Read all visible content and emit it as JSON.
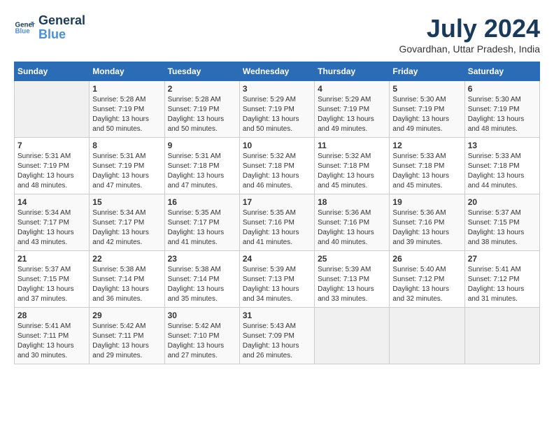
{
  "header": {
    "logo_line1": "General",
    "logo_line2": "Blue",
    "month_year": "July 2024",
    "location": "Govardhan, Uttar Pradesh, India"
  },
  "days_of_week": [
    "Sunday",
    "Monday",
    "Tuesday",
    "Wednesday",
    "Thursday",
    "Friday",
    "Saturday"
  ],
  "weeks": [
    [
      {
        "day": "",
        "content": ""
      },
      {
        "day": "1",
        "content": "Sunrise: 5:28 AM\nSunset: 7:19 PM\nDaylight: 13 hours\nand 50 minutes."
      },
      {
        "day": "2",
        "content": "Sunrise: 5:28 AM\nSunset: 7:19 PM\nDaylight: 13 hours\nand 50 minutes."
      },
      {
        "day": "3",
        "content": "Sunrise: 5:29 AM\nSunset: 7:19 PM\nDaylight: 13 hours\nand 50 minutes."
      },
      {
        "day": "4",
        "content": "Sunrise: 5:29 AM\nSunset: 7:19 PM\nDaylight: 13 hours\nand 49 minutes."
      },
      {
        "day": "5",
        "content": "Sunrise: 5:30 AM\nSunset: 7:19 PM\nDaylight: 13 hours\nand 49 minutes."
      },
      {
        "day": "6",
        "content": "Sunrise: 5:30 AM\nSunset: 7:19 PM\nDaylight: 13 hours\nand 48 minutes."
      }
    ],
    [
      {
        "day": "7",
        "content": "Sunrise: 5:31 AM\nSunset: 7:19 PM\nDaylight: 13 hours\nand 48 minutes."
      },
      {
        "day": "8",
        "content": "Sunrise: 5:31 AM\nSunset: 7:19 PM\nDaylight: 13 hours\nand 47 minutes."
      },
      {
        "day": "9",
        "content": "Sunrise: 5:31 AM\nSunset: 7:18 PM\nDaylight: 13 hours\nand 47 minutes."
      },
      {
        "day": "10",
        "content": "Sunrise: 5:32 AM\nSunset: 7:18 PM\nDaylight: 13 hours\nand 46 minutes."
      },
      {
        "day": "11",
        "content": "Sunrise: 5:32 AM\nSunset: 7:18 PM\nDaylight: 13 hours\nand 45 minutes."
      },
      {
        "day": "12",
        "content": "Sunrise: 5:33 AM\nSunset: 7:18 PM\nDaylight: 13 hours\nand 45 minutes."
      },
      {
        "day": "13",
        "content": "Sunrise: 5:33 AM\nSunset: 7:18 PM\nDaylight: 13 hours\nand 44 minutes."
      }
    ],
    [
      {
        "day": "14",
        "content": "Sunrise: 5:34 AM\nSunset: 7:17 PM\nDaylight: 13 hours\nand 43 minutes."
      },
      {
        "day": "15",
        "content": "Sunrise: 5:34 AM\nSunset: 7:17 PM\nDaylight: 13 hours\nand 42 minutes."
      },
      {
        "day": "16",
        "content": "Sunrise: 5:35 AM\nSunset: 7:17 PM\nDaylight: 13 hours\nand 41 minutes."
      },
      {
        "day": "17",
        "content": "Sunrise: 5:35 AM\nSunset: 7:16 PM\nDaylight: 13 hours\nand 41 minutes."
      },
      {
        "day": "18",
        "content": "Sunrise: 5:36 AM\nSunset: 7:16 PM\nDaylight: 13 hours\nand 40 minutes."
      },
      {
        "day": "19",
        "content": "Sunrise: 5:36 AM\nSunset: 7:16 PM\nDaylight: 13 hours\nand 39 minutes."
      },
      {
        "day": "20",
        "content": "Sunrise: 5:37 AM\nSunset: 7:15 PM\nDaylight: 13 hours\nand 38 minutes."
      }
    ],
    [
      {
        "day": "21",
        "content": "Sunrise: 5:37 AM\nSunset: 7:15 PM\nDaylight: 13 hours\nand 37 minutes."
      },
      {
        "day": "22",
        "content": "Sunrise: 5:38 AM\nSunset: 7:14 PM\nDaylight: 13 hours\nand 36 minutes."
      },
      {
        "day": "23",
        "content": "Sunrise: 5:38 AM\nSunset: 7:14 PM\nDaylight: 13 hours\nand 35 minutes."
      },
      {
        "day": "24",
        "content": "Sunrise: 5:39 AM\nSunset: 7:13 PM\nDaylight: 13 hours\nand 34 minutes."
      },
      {
        "day": "25",
        "content": "Sunrise: 5:39 AM\nSunset: 7:13 PM\nDaylight: 13 hours\nand 33 minutes."
      },
      {
        "day": "26",
        "content": "Sunrise: 5:40 AM\nSunset: 7:12 PM\nDaylight: 13 hours\nand 32 minutes."
      },
      {
        "day": "27",
        "content": "Sunrise: 5:41 AM\nSunset: 7:12 PM\nDaylight: 13 hours\nand 31 minutes."
      }
    ],
    [
      {
        "day": "28",
        "content": "Sunrise: 5:41 AM\nSunset: 7:11 PM\nDaylight: 13 hours\nand 30 minutes."
      },
      {
        "day": "29",
        "content": "Sunrise: 5:42 AM\nSunset: 7:11 PM\nDaylight: 13 hours\nand 29 minutes."
      },
      {
        "day": "30",
        "content": "Sunrise: 5:42 AM\nSunset: 7:10 PM\nDaylight: 13 hours\nand 27 minutes."
      },
      {
        "day": "31",
        "content": "Sunrise: 5:43 AM\nSunset: 7:09 PM\nDaylight: 13 hours\nand 26 minutes."
      },
      {
        "day": "",
        "content": ""
      },
      {
        "day": "",
        "content": ""
      },
      {
        "day": "",
        "content": ""
      }
    ]
  ]
}
